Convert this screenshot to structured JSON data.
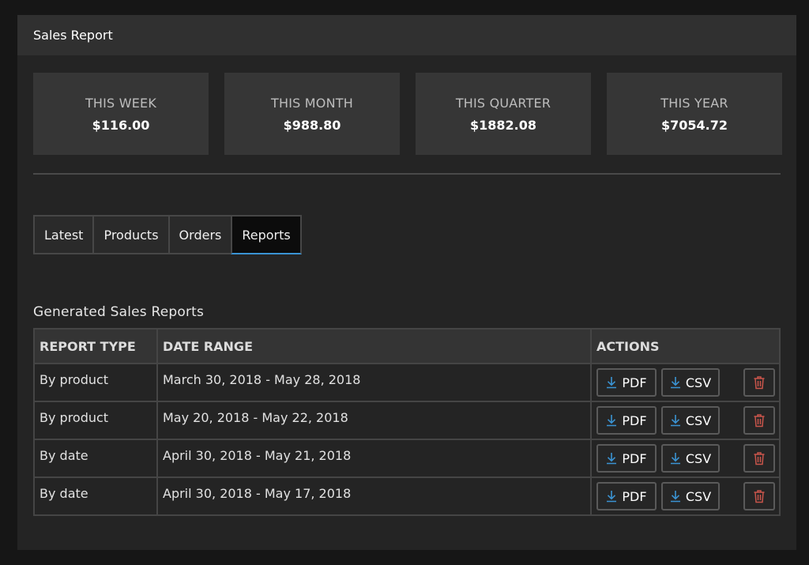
{
  "panel": {
    "title": "Sales Report"
  },
  "stats": [
    {
      "label": "THIS WEEK",
      "value": "$116.00"
    },
    {
      "label": "THIS MONTH",
      "value": "$988.80"
    },
    {
      "label": "THIS QUARTER",
      "value": "$1882.08"
    },
    {
      "label": "THIS YEAR",
      "value": "$7054.72"
    }
  ],
  "tabs": [
    {
      "label": "Latest",
      "active": false
    },
    {
      "label": "Products",
      "active": false
    },
    {
      "label": "Orders",
      "active": false
    },
    {
      "label": "Reports",
      "active": true
    }
  ],
  "reports": {
    "title": "Generated Sales Reports",
    "columns": {
      "type": "REPORT TYPE",
      "range": "DATE RANGE",
      "actions": "ACTIONS"
    },
    "pdf_label": "PDF",
    "csv_label": "CSV",
    "rows": [
      {
        "type": "By product",
        "range": "March 30, 2018 - May 28, 2018"
      },
      {
        "type": "By product",
        "range": "May 20, 2018 - May 22, 2018"
      },
      {
        "type": "By date",
        "range": "April 30, 2018 - May 21, 2018"
      },
      {
        "type": "By date",
        "range": "April 30, 2018 - May 17, 2018"
      }
    ]
  },
  "colors": {
    "accent": "#3a93d3",
    "download_icon": "#3a93d3",
    "delete_icon": "#c9554b"
  },
  "icons": {
    "download": "download-icon",
    "delete": "trash-icon"
  }
}
